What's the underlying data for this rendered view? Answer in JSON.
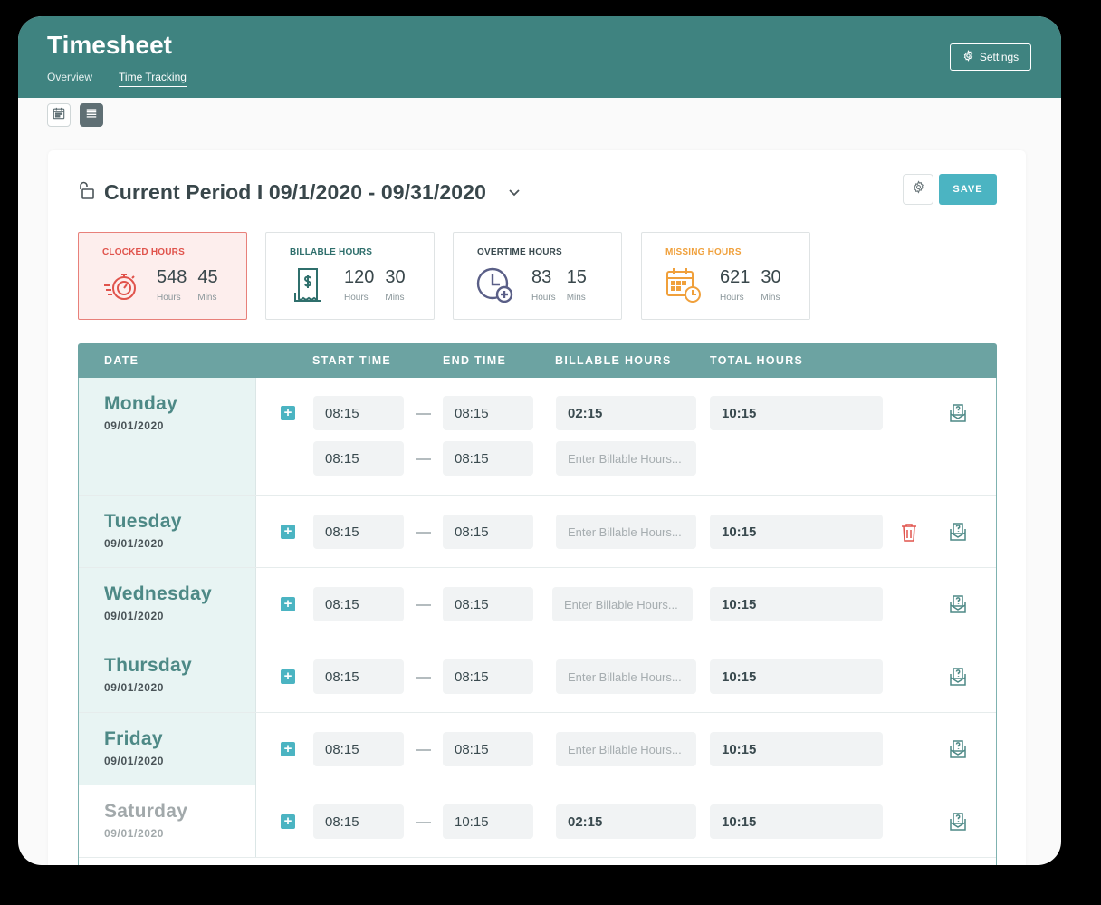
{
  "header": {
    "title": "Timesheet",
    "tabs": [
      {
        "label": "Overview",
        "active": false
      },
      {
        "label": "Time Tracking",
        "active": true
      }
    ],
    "settings_label": "Settings"
  },
  "view_toggle": {
    "calendar_icon": "calendar-icon",
    "list_icon": "list-icon",
    "active": "list"
  },
  "period": {
    "title": "Current Period I 09/1/2020 - 09/31/2020",
    "save_label": "SAVE"
  },
  "stats": [
    {
      "label": "CLOCKED HOURS",
      "icon": "stopwatch-icon",
      "hours": "548",
      "mins": "45",
      "hours_unit": "Hours",
      "mins_unit": "Mins",
      "color": "#e0534c"
    },
    {
      "label": "BILLABLE HOURS",
      "icon": "receipt-dollar-icon",
      "hours": "120",
      "mins": "30",
      "hours_unit": "Hours",
      "mins_unit": "Mins",
      "color": "#2f6f6c"
    },
    {
      "label": "OVERTIME HOURS",
      "icon": "clock-plus-icon",
      "hours": "83",
      "mins": "15",
      "hours_unit": "Hours",
      "mins_unit": "Mins",
      "color": "#5a5f87"
    },
    {
      "label": "MISSING HOURS",
      "icon": "calendar-clock-icon",
      "hours": "621",
      "mins": "30",
      "hours_unit": "Hours",
      "mins_unit": "Mins",
      "color": "#f0a03b"
    }
  ],
  "table": {
    "headers": [
      "DATE",
      "START TIME",
      "END TIME",
      "BILLABLE HOURS",
      "TOTAL HOURS"
    ],
    "billable_placeholder": "Enter Billable Hours...",
    "rows": [
      {
        "day": "Monday",
        "date": "09/01/2020",
        "entries": [
          {
            "start": "08:15",
            "end": "08:15",
            "billable": "02:15",
            "total": "10:15"
          },
          {
            "start": "08:15",
            "end": "08:15",
            "billable": ""
          }
        ]
      },
      {
        "day": "Tuesday",
        "date": "09/01/2020",
        "entries": [
          {
            "start": "08:15",
            "end": "08:15",
            "billable": "",
            "total": "10:15"
          }
        ],
        "deletable": true
      },
      {
        "day": "Wednesday",
        "date": "09/01/2020",
        "entries": [
          {
            "start": "08:15",
            "end": "08:15",
            "billable": "",
            "total": "10:15"
          }
        ]
      },
      {
        "day": "Thursday",
        "date": "09/01/2020",
        "entries": [
          {
            "start": "08:15",
            "end": "08:15",
            "billable": "",
            "total": "10:15"
          }
        ]
      },
      {
        "day": "Friday",
        "date": "09/01/2020",
        "entries": [
          {
            "start": "08:15",
            "end": "08:15",
            "billable": "",
            "total": "10:15"
          }
        ]
      },
      {
        "day": "Saturday",
        "date": "09/01/2020",
        "weekend": true,
        "entries": [
          {
            "start": "08:15",
            "end": "10:15",
            "billable": "02:15",
            "total": "10:15"
          }
        ]
      }
    ]
  }
}
